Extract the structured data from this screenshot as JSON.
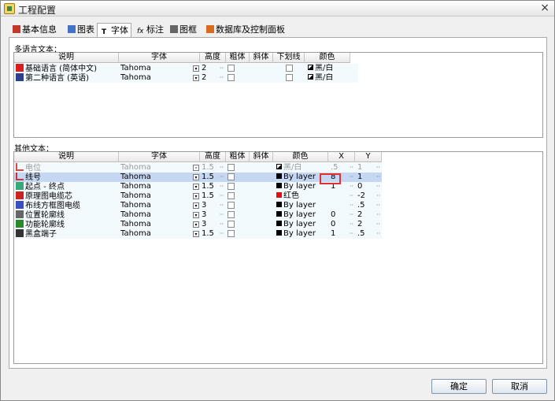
{
  "window": {
    "title": "工程配置",
    "close_glyph": "×"
  },
  "tabs": [
    {
      "label": "基本信息",
      "icon": "book-icon"
    },
    {
      "label": "图表",
      "icon": "chart-icon"
    },
    {
      "label": "字体",
      "icon": "font-icon",
      "active": true
    },
    {
      "label": "标注",
      "icon": "fx-icon"
    },
    {
      "label": "图框",
      "icon": "frame-icon"
    },
    {
      "label": "数据库及控制面板",
      "icon": "database-icon"
    }
  ],
  "multilang": {
    "label": "多语言文本：",
    "headers": [
      "说明",
      "字体",
      "高度",
      "粗体",
      "斜体",
      "下划线",
      "颜色"
    ],
    "rows": [
      {
        "desc": "基础语言 (简体中文)",
        "icon": "flag-cn-icon",
        "font": "Tahoma",
        "height": "2",
        "ellipsis": "··",
        "color": "黑/白"
      },
      {
        "desc": "第二种语言 (英语)",
        "icon": "flag-uk-icon",
        "font": "Tahoma",
        "height": "2",
        "ellipsis": "··",
        "color": "黑/白"
      }
    ]
  },
  "other": {
    "label": "其他文本：",
    "headers": [
      "说明",
      "字体",
      "高度",
      "粗体",
      "斜体",
      "颜色",
      "X",
      "Y"
    ],
    "rows": [
      {
        "desc": "电位",
        "icon": "potential-icon",
        "font": "Tahoma",
        "height": "1.5",
        "color": "黑/白",
        "swatch": "bw",
        "x": ".5",
        "y": "1",
        "dim": true
      },
      {
        "desc": "线号",
        "icon": "wire-number-icon",
        "font": "Tahoma",
        "height": "1.5",
        "color": "By layer",
        "swatch": "black",
        "x": "8",
        "y": "1",
        "selected": true
      },
      {
        "desc": "起点 - 终点",
        "icon": "start-end-icon",
        "font": "Tahoma",
        "height": "1.5",
        "color": "By layer",
        "swatch": "black",
        "x": "1",
        "y": "0"
      },
      {
        "desc": "原理图电缆芯",
        "icon": "cable-core-icon",
        "font": "Tahoma",
        "height": "1.5",
        "color": "红色",
        "swatch": "red",
        "x": "",
        "y": "-2"
      },
      {
        "desc": "布线方框图电缆",
        "icon": "wiring-cable-icon",
        "font": "Tahoma",
        "height": "3",
        "color": "By layer",
        "swatch": "black",
        "x": "",
        "y": ".5"
      },
      {
        "desc": "位置轮廓线",
        "icon": "location-outline-icon",
        "font": "Tahoma",
        "height": "3",
        "color": "By layer",
        "swatch": "black",
        "x": "0",
        "y": "2"
      },
      {
        "desc": "功能轮廓线",
        "icon": "function-outline-icon",
        "font": "Tahoma",
        "height": "3",
        "color": "By layer",
        "swatch": "black",
        "x": "0",
        "y": "2"
      },
      {
        "desc": "黑盒端子",
        "icon": "blackbox-terminal-icon",
        "font": "Tahoma",
        "height": "1.5",
        "color": "By layer",
        "swatch": "black",
        "x": "1",
        "y": ".5"
      }
    ]
  },
  "buttons": {
    "ok": "确定",
    "cancel": "取消"
  },
  "misc": {
    "ellipsis": "··",
    "dropdown_glyph": "▾"
  }
}
